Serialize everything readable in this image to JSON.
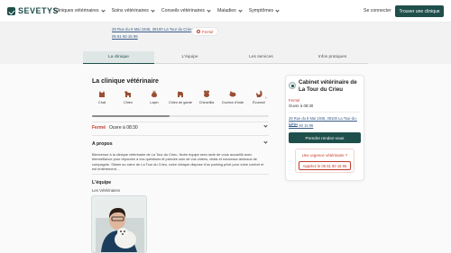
{
  "header": {
    "logo": "SEVETYS",
    "nav": [
      "Cliniques vétérinaires",
      "Soins vétérinaires",
      "Conseils vétérinaires",
      "Maladies",
      "Symptômes"
    ],
    "login": "Se connecter",
    "cta": "Trouver une clinique"
  },
  "hero": {
    "address": "29 Rue du 8 Mai 1945, 39100 La Tour du Crieu",
    "phone": "05 61 60 15 95",
    "status": "Fermé"
  },
  "tabs": [
    "La clinique",
    "L'équipe",
    "Les services",
    "Infos pratiques"
  ],
  "clinic": {
    "heading": "La clinique vétérinaire",
    "animals": [
      "Chat",
      "Chien",
      "Lapin",
      "Chien de garde",
      "Chinchilla",
      "Cochon d'Inde",
      "Écureuil"
    ],
    "status_label": "Fermé",
    "hours_text": "Ouvre à 08:30",
    "about_title": "A propos",
    "about_text": "Bienvenue à la clinique vétérinaire de La Tour du Crieu. Notre équipe sera ravie de vous accueillir avec bienveillance pour répondre à vos questions et prendre soin de vos chiens, chats et nouveaux animaux de compagnie. Située au cœur de La Tour du Crieu, notre clinique dispose d'un parking privé pour votre confort et est entièrement…",
    "team_title": "L'équipe",
    "vets_label": "Les Vétérinaires"
  },
  "card": {
    "title": "Cabinet vétérinaire de La Tour du Crieu",
    "status": "Fermé",
    "hours": "Ouvre à 08:30",
    "address": "29 Rue du 8 Mai 1945, 39100 La Tour-du-Crieu",
    "phone": "05 61 60 15 95",
    "rdv_button": "Prendre rendez-vous",
    "urgency_title": "Une urgence vétérinaire ?",
    "urgency_button": "Appelez le 05 61 60 15 95"
  },
  "colors": {
    "brand": "#1f4f4b",
    "alert": "#c0392b",
    "link": "#3a5c8a"
  }
}
